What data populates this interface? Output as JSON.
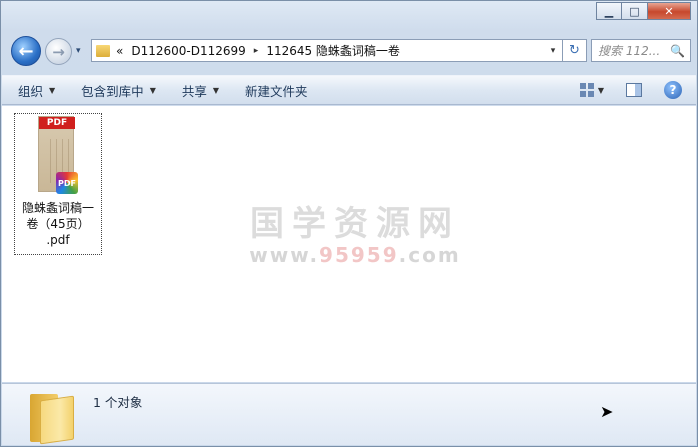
{
  "window": {
    "minimize": "▁",
    "maximize": "□",
    "close": "✕"
  },
  "nav": {
    "back_icon": "←",
    "forward_icon": "→",
    "recent_icon": "▾",
    "address": {
      "overflow": "«",
      "segments": [
        "D112600-D112699",
        "112645 隐蛛螽词稿一卷"
      ],
      "separator": "▸",
      "dropdown": "▾"
    },
    "refresh_icon": "↻",
    "search_placeholder": "搜索 112...",
    "search_icon": "🔍"
  },
  "toolbar": {
    "organize": "组织",
    "include_in_library": "包含到库中",
    "share": "共享",
    "new_folder": "新建文件夹",
    "dropdown": "▼",
    "view_dropdown": "▼",
    "help": "?"
  },
  "files": [
    {
      "name_line1": "隐蛛螽词稿一",
      "name_line2": "卷（45页）",
      "name_line3": ".pdf",
      "thumb_band": "PDF",
      "badge": "PDF"
    }
  ],
  "watermark": {
    "cn": "国学资源网",
    "url_prefix": "www.",
    "url_num": "95959",
    "url_suffix": ".com"
  },
  "details": {
    "count": "1 个对象"
  }
}
